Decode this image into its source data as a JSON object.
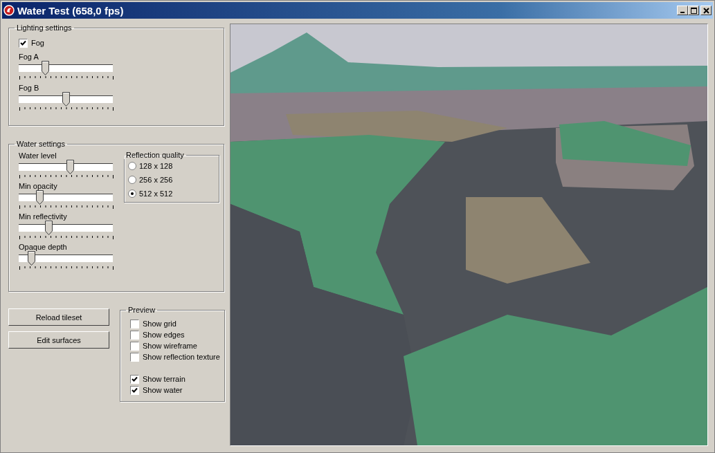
{
  "window": {
    "title": "Water Test (658,0 fps)"
  },
  "lighting": {
    "title": "Lighting settings",
    "fog": {
      "label": "Fog",
      "checked": true
    },
    "sliders": [
      {
        "label": "Fog A",
        "level": 0.26
      },
      {
        "label": "Fog B",
        "level": 0.5
      }
    ]
  },
  "water": {
    "title": "Water settings",
    "sliders": [
      {
        "label": "Water level",
        "level": 0.55
      },
      {
        "label": "Min opacity",
        "level": 0.2
      },
      {
        "label": "Min reflectivity",
        "level": 0.3
      },
      {
        "label": "Opaque depth",
        "level": 0.1
      }
    ],
    "reflection_quality": {
      "title": "Reflection quality",
      "options": [
        {
          "label": "128 x 128",
          "selected": false
        },
        {
          "label": "256 x 256",
          "selected": false
        },
        {
          "label": "512 x 512",
          "selected": true
        }
      ]
    }
  },
  "buttons": [
    "Reload tileset",
    "Edit surfaces"
  ],
  "preview": {
    "title": "Preview",
    "option_groups": [
      [
        {
          "label": "Show grid",
          "checked": false
        },
        {
          "label": "Show edges",
          "checked": false
        },
        {
          "label": "Show wireframe",
          "checked": false
        },
        {
          "label": "Show reflection texture",
          "checked": false
        }
      ],
      [
        {
          "label": "Show terrain",
          "checked": true
        },
        {
          "label": "Show water",
          "checked": true
        }
      ]
    ]
  }
}
